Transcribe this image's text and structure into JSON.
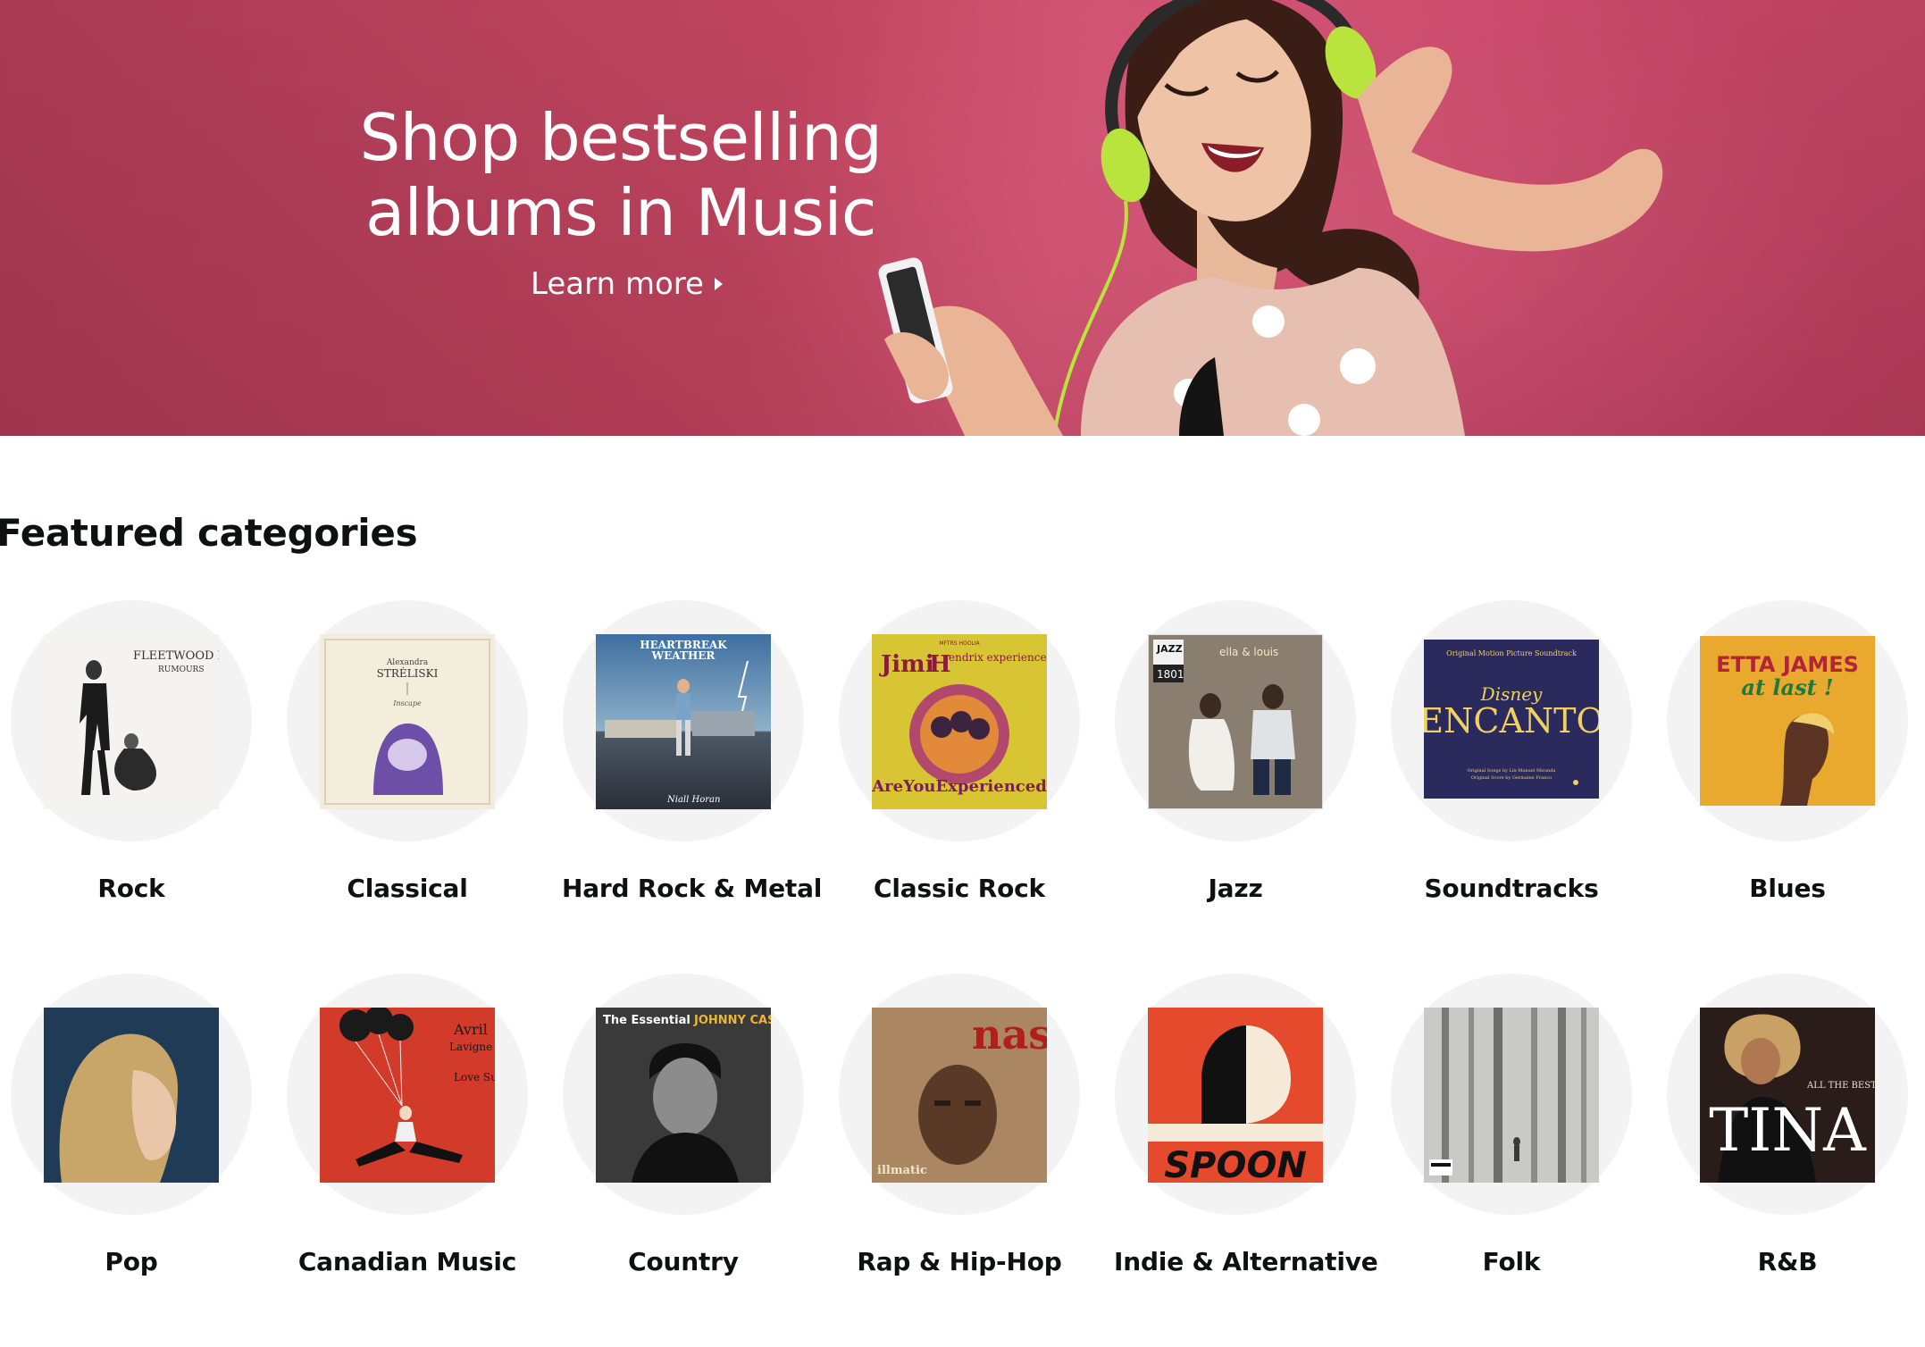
{
  "hero": {
    "title": "Shop bestselling\nalbums in Music",
    "cta_label": "Learn more"
  },
  "featured": {
    "title": "Featured categories",
    "categories": [
      {
        "label": "Rock",
        "cover_text": "FLEETWOOD MAC RUMOURS"
      },
      {
        "label": "Classical",
        "cover_text": "Alexandra STRĖLISKI Inscape"
      },
      {
        "label": "Hard Rock & Metal",
        "cover_text": "HEARTBREAK WEATHER Niall Horan"
      },
      {
        "label": "Classic Rock",
        "cover_text": "The Jimi Hendrix experience Are You Experienced"
      },
      {
        "label": "Jazz",
        "cover_text": "JAZZ 1801 ella & louis"
      },
      {
        "label": "Soundtracks",
        "cover_text": "Original Motion Picture Soundtrack Disney ENCANTO"
      },
      {
        "label": "Blues",
        "cover_text": "ETTA JAMES at last !"
      },
      {
        "label": "Pop",
        "cover_text": ""
      },
      {
        "label": "Canadian Music",
        "cover_text": "Avril Lavigne Love Sux"
      },
      {
        "label": "Country",
        "cover_text": "The Essential JOHNNY CASH"
      },
      {
        "label": "Rap & Hip-Hop",
        "cover_text": "nas illmatic"
      },
      {
        "label": "Indie & Alternative",
        "cover_text": "SPOON"
      },
      {
        "label": "Folk",
        "cover_text": ""
      },
      {
        "label": "R&B",
        "cover_text": "ALL THE BEST TINA"
      }
    ]
  },
  "colors": {
    "hero_bg": "#c0455f",
    "disc_bg": "#f3f3f3",
    "text": "#0f1111"
  }
}
